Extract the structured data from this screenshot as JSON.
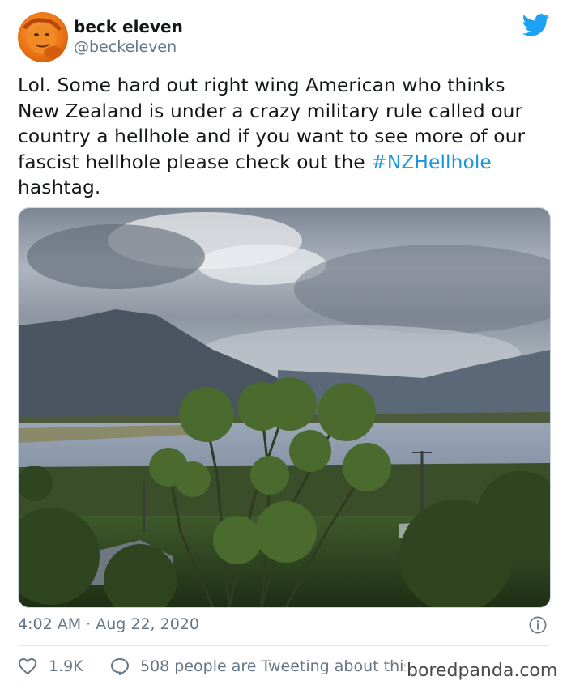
{
  "user": {
    "display_name": "beck eleven",
    "handle": "@beckeleven",
    "avatar_icon": "orange-avatar"
  },
  "brand_icon": "twitter-bird-icon",
  "tweet": {
    "text_before": "Lol. Some hard out right wing American who thinks New Zealand is under a crazy military rule called our country a hellhole and if you want to see more of our fascist hellhole please check out the ",
    "hashtag": "#NZHellhole",
    "text_after": " hashtag."
  },
  "photo": {
    "subject": "lake-mountains-cabbage-trees"
  },
  "meta": {
    "timestamp": "4:02 AM · Aug 22, 2020"
  },
  "actions": {
    "likes": "1.9K",
    "conversation": "508 people are Tweeting about this"
  },
  "watermark": "boredpanda.com",
  "colors": {
    "link": "#1b95e0",
    "secondary_text": "#657786",
    "twitter_blue": "#1da1f2"
  }
}
